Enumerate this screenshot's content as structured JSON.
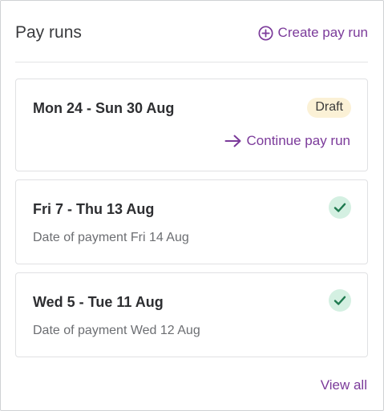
{
  "header": {
    "title": "Pay runs",
    "create_label": "Create pay run"
  },
  "pay_runs": [
    {
      "period": "Mon 24 - Sun 30 Aug",
      "status": "Draft",
      "action_label": "Continue pay run"
    },
    {
      "period": "Fri 7 - Thu 13 Aug",
      "status": "paid",
      "payment_date": "Date of payment Fri 14 Aug"
    },
    {
      "period": "Wed 5 - Tue 11 Aug",
      "status": "paid",
      "payment_date": "Date of payment Wed 12 Aug"
    }
  ],
  "footer": {
    "view_all_label": "View all"
  },
  "icons": {
    "create": "plus-circle-icon",
    "continue": "arrow-right-icon",
    "paid": "check-icon"
  },
  "colors": {
    "accent": "#7b3a9a",
    "draft_badge_bg": "#fbf1d6",
    "paid_badge_bg": "#d4f0e2",
    "paid_check": "#1f7a50"
  }
}
